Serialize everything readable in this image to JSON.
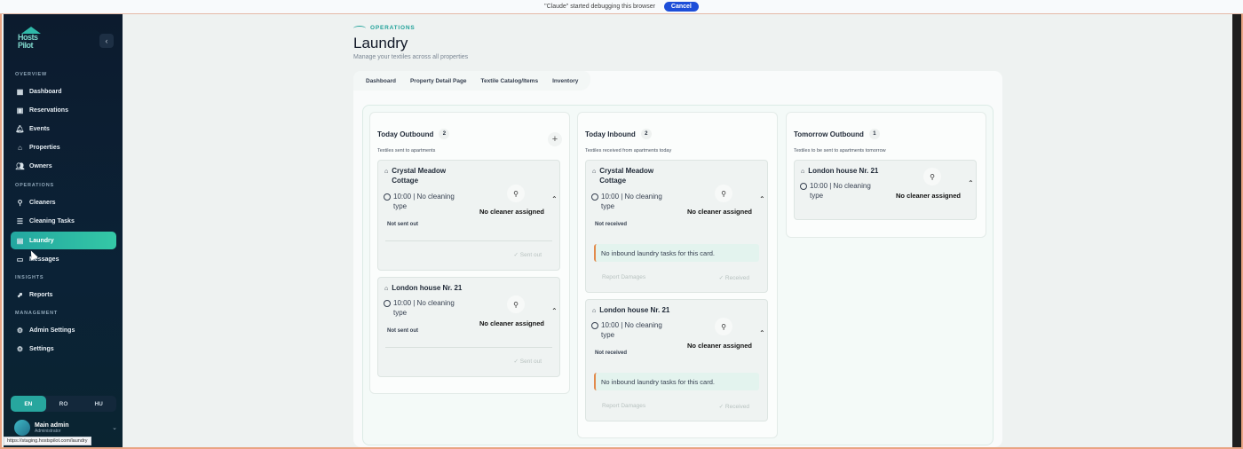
{
  "debug_bar": {
    "message": "\"Claude\" started debugging this browser",
    "cancel": "Cancel"
  },
  "sidebar": {
    "logo_text": "Hosts Pilot",
    "sections": {
      "overview": "OVERVIEW",
      "operations": "OPERATIONS",
      "insights": "INSIGHTS",
      "management": "MANAGEMENT"
    },
    "items": [
      {
        "label": "Dashboard",
        "icon": "dashboard-icon"
      },
      {
        "label": "Reservations",
        "icon": "calendar-icon"
      },
      {
        "label": "Events",
        "icon": "bell-icon"
      },
      {
        "label": "Properties",
        "icon": "home-icon"
      },
      {
        "label": "Owners",
        "icon": "users-icon"
      },
      {
        "label": "Cleaners",
        "icon": "broom-icon"
      },
      {
        "label": "Cleaning Tasks",
        "icon": "checklist-icon"
      },
      {
        "label": "Laundry",
        "icon": "laundry-icon"
      },
      {
        "label": "Messages",
        "icon": "chat-icon"
      },
      {
        "label": "Reports",
        "icon": "chart-icon"
      },
      {
        "label": "Admin Settings",
        "icon": "admin-gear-icon"
      },
      {
        "label": "Settings",
        "icon": "gear-icon"
      }
    ],
    "languages": [
      "EN",
      "RO",
      "HU"
    ],
    "active_language": "EN",
    "user": {
      "name": "Main admin",
      "role": "Administrator"
    },
    "status_url": "https://staging.hostspilot.com/laundry"
  },
  "header": {
    "crumb": "OPERATIONS",
    "title": "Laundry",
    "subtitle": "Manage your textiles across all properties"
  },
  "tabs": [
    "Dashboard",
    "Property Detail Page",
    "Textile Catalog/Items",
    "Inventory"
  ],
  "columns": [
    {
      "title": "Today Outbound",
      "count": "2",
      "subtitle": "Textiles sent to apartments",
      "cards": [
        {
          "property": "Crystal Meadow Cottage",
          "time": "10:00 | No cleaning type",
          "cleaner": "No cleaner assigned",
          "status": "Not sent out",
          "action": "Sent out"
        },
        {
          "property": "London house Nr. 21",
          "time": "10:00 | No cleaning type",
          "cleaner": "No cleaner assigned",
          "status": "Not sent out",
          "action": "Sent out"
        }
      ]
    },
    {
      "title": "Today Inbound",
      "count": "2",
      "subtitle": "Textiles received from apartments today",
      "cards": [
        {
          "property": "Crystal Meadow Cottage",
          "time": "10:00 | No cleaning type",
          "cleaner": "No cleaner assigned",
          "status": "Not received",
          "note": "No inbound laundry tasks for this card.",
          "damages": "Report Damages",
          "action": "Received"
        },
        {
          "property": "London house Nr. 21",
          "time": "10:00 | No cleaning type",
          "cleaner": "No cleaner assigned",
          "status": "Not received",
          "note": "No inbound laundry tasks for this card.",
          "damages": "Report Damages",
          "action": "Received"
        }
      ]
    },
    {
      "title": "Tomorrow Outbound",
      "count": "1",
      "subtitle": "Textiles to be sent to apartments tomorrow",
      "cards": [
        {
          "property": "London house Nr. 21",
          "time": "10:00 | No cleaning type",
          "cleaner": "No cleaner assigned"
        }
      ]
    }
  ]
}
